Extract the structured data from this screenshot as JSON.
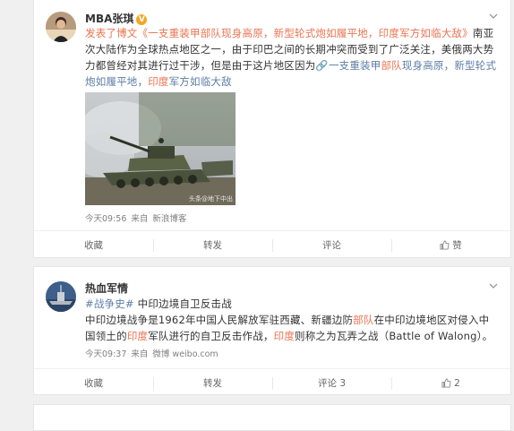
{
  "posts": [
    {
      "username": "MBA张琪",
      "text_segments": [
        {
          "t": "发表了博文《一支重装甲",
          "c": "link"
        },
        {
          "t": "部队",
          "c": "link"
        },
        {
          "t": "现身高原，新型轮式炮如履平地，",
          "c": "link"
        },
        {
          "t": "印度",
          "c": "link"
        },
        {
          "t": "军方如临大敌》",
          "c": "link"
        },
        {
          "t": "南亚次大陆作为全球热点地区之一，由于印巴之间的长期冲突而受到了广泛关注，美俄两大势力都曾经对其进行过干涉，但是由于这片地区因为",
          "c": "normal"
        },
        {
          "t": "🔗",
          "c": "blue"
        },
        {
          "t": "一支重装甲",
          "c": "blue"
        },
        {
          "t": "部队",
          "c": "link"
        },
        {
          "t": "现身高原，新型轮式炮如履平地，",
          "c": "blue"
        },
        {
          "t": "印度",
          "c": "link"
        },
        {
          "t": "军方如临大敌",
          "c": "blue"
        }
      ],
      "image_watermark": "头条@地下中出",
      "time": "今天09:56",
      "source_prefix": "来自",
      "source": "新浪博客",
      "actions": {
        "favorite": "收藏",
        "repost": "转发",
        "comment": "评论",
        "like": "赞"
      }
    },
    {
      "username": "热血军情",
      "tag": "#战争史#",
      "headline": "中印边境自卫反击战",
      "text_segments": [
        {
          "t": "中印边境战争是1962年中国人民解放军驻西藏、新疆边防",
          "c": "normal"
        },
        {
          "t": "部队",
          "c": "link"
        },
        {
          "t": "在中印边境地区对侵入中国领土的",
          "c": "normal"
        },
        {
          "t": "印度",
          "c": "link"
        },
        {
          "t": "军队进行的自卫反击作战，",
          "c": "normal"
        },
        {
          "t": "印度",
          "c": "link"
        },
        {
          "t": "则称之为瓦弄之战（Battle of Walong）。",
          "c": "normal"
        }
      ],
      "time": "今天09:37",
      "source_prefix": "来自",
      "source": "微博 weibo.com",
      "actions": {
        "favorite": "收藏",
        "repost": "转发",
        "comment": "评论 3",
        "like": "2"
      }
    }
  ],
  "colors": {
    "accent": "#eb7350",
    "link_blue": "#5d7ea6",
    "badge": "#f5a623"
  }
}
